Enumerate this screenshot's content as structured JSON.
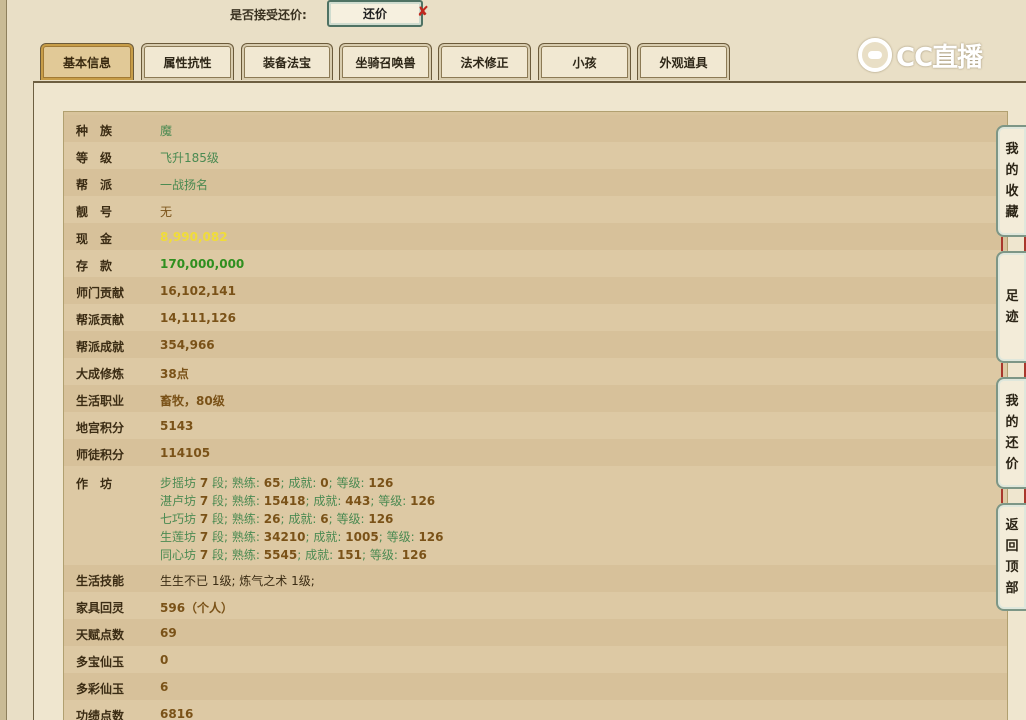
{
  "offer": {
    "label": "是否接受还价:",
    "button": "还价",
    "x_mark": "✘"
  },
  "tabs": [
    "基本信息",
    "属性抗性",
    "装备法宝",
    "坐骑召唤兽",
    "法术修正",
    "小孩",
    "外观道具"
  ],
  "logo": {
    "text": "CC直播"
  },
  "side_buttons": [
    [
      "我",
      "的",
      "收",
      "藏"
    ],
    [
      "足",
      "迹"
    ],
    [
      "我",
      "的",
      "还",
      "价"
    ],
    [
      "返",
      "回",
      "顶",
      "部"
    ]
  ],
  "rows": [
    {
      "key": "种　族",
      "value": "魔"
    },
    {
      "key": "等　级",
      "value": "飞升185级"
    },
    {
      "key": "帮　派",
      "value": "一战扬名"
    },
    {
      "key": "靓　号",
      "value": "无"
    },
    {
      "key": "现　金",
      "value": "8,990,082"
    },
    {
      "key": "存　款",
      "value": "170,000,000"
    },
    {
      "key": "师门贡献",
      "value": "16,102,141"
    },
    {
      "key": "帮派贡献",
      "value": "14,111,126"
    },
    {
      "key": "帮派成就",
      "value": "354,966"
    },
    {
      "key": "大成修炼",
      "value": "38点"
    },
    {
      "key": "生活职业",
      "value": "畜牧，80级"
    },
    {
      "key": "地宫积分",
      "value": "5143"
    },
    {
      "key": "师徒积分",
      "value": "114105"
    },
    {
      "key": "作　坊",
      "value": ""
    },
    {
      "key": "生活技能",
      "value": "生生不已 1级; 炼气之术 1级;"
    },
    {
      "key": "家具回灵",
      "value": "596（个人）"
    },
    {
      "key": "天赋点数",
      "value": "69"
    },
    {
      "key": "多宝仙玉",
      "value": "0"
    },
    {
      "key": "多彩仙玉",
      "value": "6"
    },
    {
      "key": "功绩点数",
      "value": "6816"
    }
  ],
  "workshop": [
    {
      "name": "步摇坊",
      "level": "7",
      "seg": "段;",
      "prof_label": "熟练:",
      "prof": "65",
      "ach_label": "成就:",
      "ach": "0",
      "grade_label": "等级:",
      "grade": "126"
    },
    {
      "name": "湛卢坊",
      "level": "7",
      "seg": "段;",
      "prof_label": "熟练:",
      "prof": "15418",
      "ach_label": "成就:",
      "ach": "443",
      "grade_label": "等级:",
      "grade": "126"
    },
    {
      "name": "七巧坊",
      "level": "7",
      "seg": "段;",
      "prof_label": "熟练:",
      "prof": "26",
      "ach_label": "成就:",
      "ach": "6",
      "grade_label": "等级:",
      "grade": "126"
    },
    {
      "name": "生莲坊",
      "level": "7",
      "seg": "段;",
      "prof_label": "熟练:",
      "prof": "34210",
      "ach_label": "成就:",
      "ach": "1005",
      "grade_label": "等级:",
      "grade": "126"
    },
    {
      "name": "同心坊",
      "level": "7",
      "seg": "段;",
      "prof_label": "熟练:",
      "prof": "5545",
      "ach_label": "成就:",
      "ach": "151",
      "grade_label": "等级:",
      "grade": "126"
    }
  ]
}
